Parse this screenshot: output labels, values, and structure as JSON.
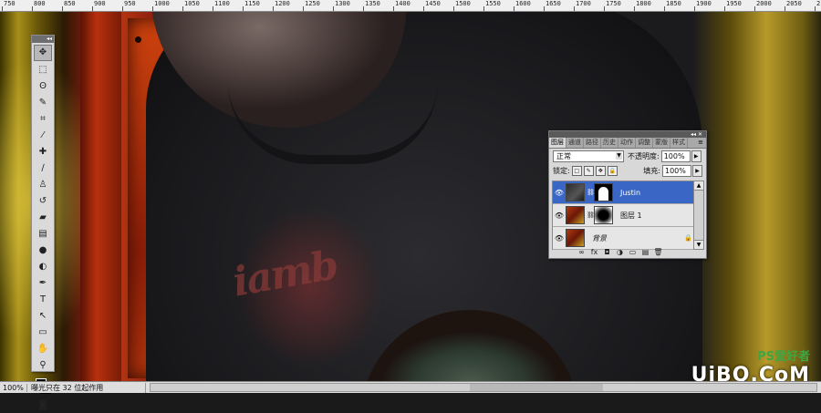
{
  "ruler": {
    "labels": [
      "750",
      "800",
      "850",
      "900",
      "950",
      "1000",
      "1050",
      "1100",
      "1150",
      "1200",
      "1250",
      "1300",
      "1350",
      "1400",
      "1450",
      "1500",
      "1550",
      "1600",
      "1650",
      "1700",
      "1750",
      "1800",
      "1850",
      "1900",
      "1950",
      "2000",
      "2050",
      "2100"
    ]
  },
  "canvas": {
    "print_text": "iamb"
  },
  "toolbox": {
    "header": "◂◂",
    "tools": [
      {
        "name": "move-tool",
        "glyph": "✥"
      },
      {
        "name": "marquee-tool",
        "glyph": "⬚"
      },
      {
        "name": "lasso-tool",
        "glyph": "ʘ"
      },
      {
        "name": "quick-select-tool",
        "glyph": "✎"
      },
      {
        "name": "crop-tool",
        "glyph": "⌗"
      },
      {
        "name": "eyedropper-tool",
        "glyph": "⁄"
      },
      {
        "name": "healing-brush-tool",
        "glyph": "✚"
      },
      {
        "name": "brush-tool",
        "glyph": "∕"
      },
      {
        "name": "clone-stamp-tool",
        "glyph": "♙"
      },
      {
        "name": "history-brush-tool",
        "glyph": "↺"
      },
      {
        "name": "eraser-tool",
        "glyph": "▰"
      },
      {
        "name": "gradient-tool",
        "glyph": "▤"
      },
      {
        "name": "blur-tool",
        "glyph": "●"
      },
      {
        "name": "dodge-tool",
        "glyph": "◐"
      },
      {
        "name": "pen-tool",
        "glyph": "✒"
      },
      {
        "name": "type-tool",
        "glyph": "T"
      },
      {
        "name": "path-select-tool",
        "glyph": "↖"
      },
      {
        "name": "shape-tool",
        "glyph": "▭"
      },
      {
        "name": "hand-tool",
        "glyph": "✋"
      },
      {
        "name": "zoom-tool",
        "glyph": "⚲"
      }
    ],
    "quickmask": "◙"
  },
  "layers_panel": {
    "header": "◂◂ ✕",
    "tabs": [
      "图层",
      "通道",
      "路径",
      "历史",
      "动作",
      "调整",
      "蒙版",
      "样式"
    ],
    "tab_menu": "≡",
    "blend_mode": "正常",
    "opacity_label": "不透明度:",
    "opacity_value": "100%",
    "lock_label": "锁定:",
    "fill_label": "填充:",
    "fill_value": "100%",
    "layers": [
      {
        "name": "Justin",
        "selected": true,
        "italic": false
      },
      {
        "name": "图层 1",
        "selected": false,
        "italic": false
      },
      {
        "name": "背景",
        "selected": false,
        "italic": true,
        "locked": true
      }
    ],
    "bottom_icons": [
      "∞",
      "fx",
      "◘",
      "◑",
      "▭",
      "▤",
      "🗑"
    ]
  },
  "status": {
    "zoom": "100%",
    "info": "曝光只在 32 位起作用"
  },
  "watermark": {
    "top": "PS爱好者",
    "main": "UiBQ.CoM"
  }
}
